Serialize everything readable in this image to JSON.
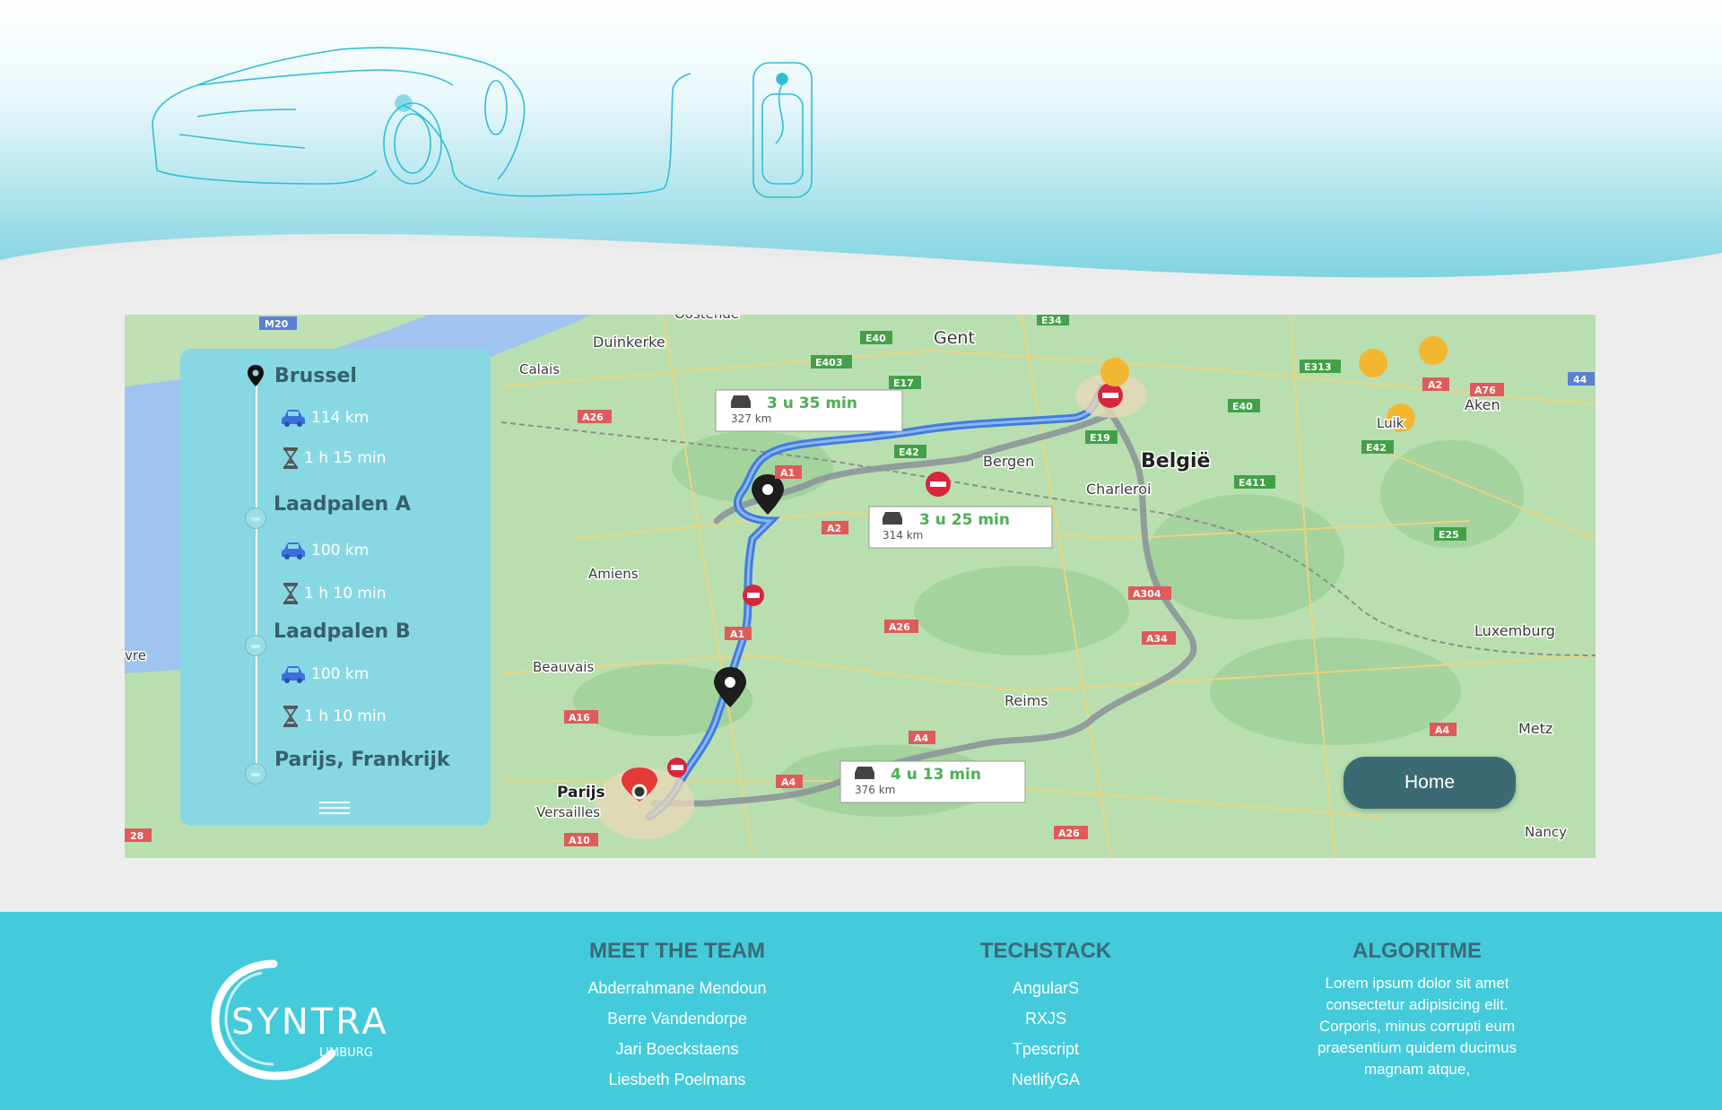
{
  "route": {
    "stops": [
      {
        "name": "Brussel"
      },
      {
        "name": "Laadpalen A"
      },
      {
        "name": "Laadpalen B"
      },
      {
        "name": "Parijs, Frankrijk"
      }
    ],
    "legs": [
      {
        "distance": "114 km",
        "duration": "1 h 15 min"
      },
      {
        "distance": "100 km",
        "duration": "1 h 10 min"
      },
      {
        "distance": "100 km",
        "duration": "1 h 10 min"
      }
    ]
  },
  "map": {
    "callouts": [
      {
        "time": "3 u 35 min",
        "distance": "327 km"
      },
      {
        "time": "3 u 25 min",
        "distance": "314 km"
      },
      {
        "time": "4 u 13 min",
        "distance": "376 km"
      }
    ],
    "places": [
      "Oostende",
      "Duinkerke",
      "Calais",
      "Gent",
      "Bergen",
      "België",
      "Charleroi",
      "Amiens",
      "Beauvais",
      "Reims",
      "Parijs",
      "Versailles",
      "Aken",
      "Luxemburg",
      "Metz",
      "Nancy",
      "Luik",
      "vre"
    ],
    "roads": [
      "M20",
      "E40",
      "E34",
      "E403",
      "E17",
      "E313",
      "E42",
      "E19",
      "E411",
      "E25",
      "A1",
      "A2",
      "A26",
      "A304",
      "A34",
      "A16",
      "A4",
      "A10",
      "A2",
      "A76",
      "44",
      "28"
    ]
  },
  "home_button": {
    "label": "Home"
  },
  "footer": {
    "logo": {
      "text": "SYNTRA",
      "sub": "LIMBURG"
    },
    "team": {
      "title": "MEET THE TEAM",
      "members": [
        "Abderrahmane Mendoun",
        "Berre Vandendorpe",
        "Jari Boeckstaens",
        "Liesbeth Poelmans"
      ]
    },
    "techstack": {
      "title": "TECHSTACK",
      "items": [
        "AngularS",
        "RXJS",
        "Tpescript",
        "NetlifyGA"
      ]
    },
    "algoritme": {
      "title": "ALGORITME",
      "text": "Lorem ipsum dolor sit amet consectetur adipisicing elit. Corporis, minus corrupti eum praesentium quidem ducimus magnam atque,"
    }
  },
  "colors": {
    "header_wave": "#7fd3e1",
    "panel": "#88d8e4",
    "footer": "#43cbdc",
    "button": "#3c6a73",
    "route_blue": "#3f7de0",
    "route_grey": "#9aa3a8"
  },
  "icons": [
    "map-pin-icon",
    "car-icon",
    "hourglass-icon",
    "charger-dot-icon",
    "menu-icon",
    "car-charging-illustration"
  ]
}
